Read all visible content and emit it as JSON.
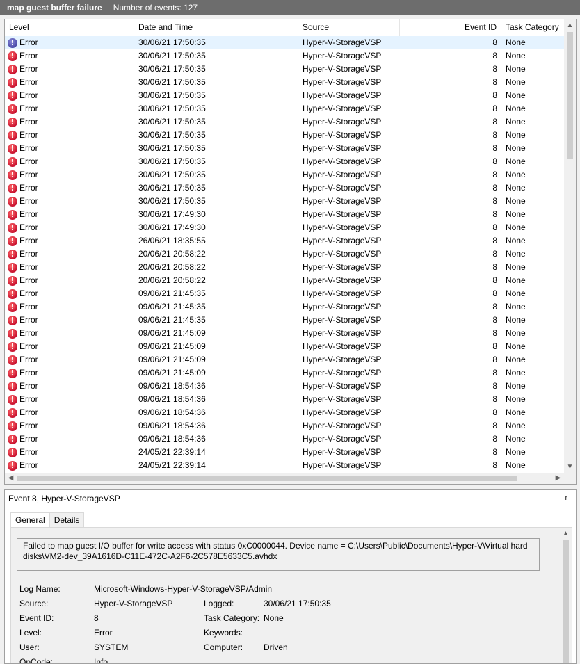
{
  "title": {
    "name": "map guest buffer failure",
    "count": "Number of events: 127"
  },
  "columns": {
    "level": "Level",
    "date": "Date and Time",
    "source": "Source",
    "event_id": "Event ID",
    "category": "Task Category"
  },
  "events": [
    {
      "level": "Error",
      "date": "30/06/21 17:50:35",
      "source": "Hyper-V-StorageVSP",
      "event_id": "8",
      "category": "None",
      "selected": true
    },
    {
      "level": "Error",
      "date": "30/06/21 17:50:35",
      "source": "Hyper-V-StorageVSP",
      "event_id": "8",
      "category": "None"
    },
    {
      "level": "Error",
      "date": "30/06/21 17:50:35",
      "source": "Hyper-V-StorageVSP",
      "event_id": "8",
      "category": "None"
    },
    {
      "level": "Error",
      "date": "30/06/21 17:50:35",
      "source": "Hyper-V-StorageVSP",
      "event_id": "8",
      "category": "None"
    },
    {
      "level": "Error",
      "date": "30/06/21 17:50:35",
      "source": "Hyper-V-StorageVSP",
      "event_id": "8",
      "category": "None"
    },
    {
      "level": "Error",
      "date": "30/06/21 17:50:35",
      "source": "Hyper-V-StorageVSP",
      "event_id": "8",
      "category": "None"
    },
    {
      "level": "Error",
      "date": "30/06/21 17:50:35",
      "source": "Hyper-V-StorageVSP",
      "event_id": "8",
      "category": "None"
    },
    {
      "level": "Error",
      "date": "30/06/21 17:50:35",
      "source": "Hyper-V-StorageVSP",
      "event_id": "8",
      "category": "None"
    },
    {
      "level": "Error",
      "date": "30/06/21 17:50:35",
      "source": "Hyper-V-StorageVSP",
      "event_id": "8",
      "category": "None"
    },
    {
      "level": "Error",
      "date": "30/06/21 17:50:35",
      "source": "Hyper-V-StorageVSP",
      "event_id": "8",
      "category": "None"
    },
    {
      "level": "Error",
      "date": "30/06/21 17:50:35",
      "source": "Hyper-V-StorageVSP",
      "event_id": "8",
      "category": "None"
    },
    {
      "level": "Error",
      "date": "30/06/21 17:50:35",
      "source": "Hyper-V-StorageVSP",
      "event_id": "8",
      "category": "None"
    },
    {
      "level": "Error",
      "date": "30/06/21 17:50:35",
      "source": "Hyper-V-StorageVSP",
      "event_id": "8",
      "category": "None"
    },
    {
      "level": "Error",
      "date": "30/06/21 17:49:30",
      "source": "Hyper-V-StorageVSP",
      "event_id": "8",
      "category": "None"
    },
    {
      "level": "Error",
      "date": "30/06/21 17:49:30",
      "source": "Hyper-V-StorageVSP",
      "event_id": "8",
      "category": "None"
    },
    {
      "level": "Error",
      "date": "26/06/21 18:35:55",
      "source": "Hyper-V-StorageVSP",
      "event_id": "8",
      "category": "None"
    },
    {
      "level": "Error",
      "date": "20/06/21 20:58:22",
      "source": "Hyper-V-StorageVSP",
      "event_id": "8",
      "category": "None"
    },
    {
      "level": "Error",
      "date": "20/06/21 20:58:22",
      "source": "Hyper-V-StorageVSP",
      "event_id": "8",
      "category": "None"
    },
    {
      "level": "Error",
      "date": "20/06/21 20:58:22",
      "source": "Hyper-V-StorageVSP",
      "event_id": "8",
      "category": "None"
    },
    {
      "level": "Error",
      "date": "09/06/21 21:45:35",
      "source": "Hyper-V-StorageVSP",
      "event_id": "8",
      "category": "None"
    },
    {
      "level": "Error",
      "date": "09/06/21 21:45:35",
      "source": "Hyper-V-StorageVSP",
      "event_id": "8",
      "category": "None"
    },
    {
      "level": "Error",
      "date": "09/06/21 21:45:35",
      "source": "Hyper-V-StorageVSP",
      "event_id": "8",
      "category": "None"
    },
    {
      "level": "Error",
      "date": "09/06/21 21:45:09",
      "source": "Hyper-V-StorageVSP",
      "event_id": "8",
      "category": "None"
    },
    {
      "level": "Error",
      "date": "09/06/21 21:45:09",
      "source": "Hyper-V-StorageVSP",
      "event_id": "8",
      "category": "None"
    },
    {
      "level": "Error",
      "date": "09/06/21 21:45:09",
      "source": "Hyper-V-StorageVSP",
      "event_id": "8",
      "category": "None"
    },
    {
      "level": "Error",
      "date": "09/06/21 21:45:09",
      "source": "Hyper-V-StorageVSP",
      "event_id": "8",
      "category": "None"
    },
    {
      "level": "Error",
      "date": "09/06/21 18:54:36",
      "source": "Hyper-V-StorageVSP",
      "event_id": "8",
      "category": "None"
    },
    {
      "level": "Error",
      "date": "09/06/21 18:54:36",
      "source": "Hyper-V-StorageVSP",
      "event_id": "8",
      "category": "None"
    },
    {
      "level": "Error",
      "date": "09/06/21 18:54:36",
      "source": "Hyper-V-StorageVSP",
      "event_id": "8",
      "category": "None"
    },
    {
      "level": "Error",
      "date": "09/06/21 18:54:36",
      "source": "Hyper-V-StorageVSP",
      "event_id": "8",
      "category": "None"
    },
    {
      "level": "Error",
      "date": "09/06/21 18:54:36",
      "source": "Hyper-V-StorageVSP",
      "event_id": "8",
      "category": "None"
    },
    {
      "level": "Error",
      "date": "24/05/21 22:39:14",
      "source": "Hyper-V-StorageVSP",
      "event_id": "8",
      "category": "None"
    },
    {
      "level": "Error",
      "date": "24/05/21 22:39:14",
      "source": "Hyper-V-StorageVSP",
      "event_id": "8",
      "category": "None"
    }
  ],
  "details": {
    "title": "Event 8, Hyper-V-StorageVSP",
    "close_glyph": "r",
    "tabs": {
      "general": "General",
      "details": "Details"
    },
    "message": "Failed to map guest I/O buffer for write access with status 0xC0000044. Device name = C:\\Users\\Public\\Documents\\Hyper-V\\Virtual hard disks\\VM2-dev_39A1616D-C11E-472C-A2F6-2C578E5633C5.avhdx",
    "fields": {
      "log_name_label": "Log Name:",
      "log_name": "Microsoft-Windows-Hyper-V-StorageVSP/Admin",
      "source_label": "Source:",
      "source": "Hyper-V-StorageVSP",
      "logged_label": "Logged:",
      "logged": "30/06/21 17:50:35",
      "event_id_label": "Event ID:",
      "event_id": "8",
      "task_category_label": "Task Category:",
      "task_category": "None",
      "level_label": "Level:",
      "level": "Error",
      "keywords_label": "Keywords:",
      "keywords": "",
      "user_label": "User:",
      "user": "SYSTEM",
      "computer_label": "Computer:",
      "computer": "Driven",
      "opcode_label": "OpCode:",
      "opcode": "Info"
    }
  }
}
